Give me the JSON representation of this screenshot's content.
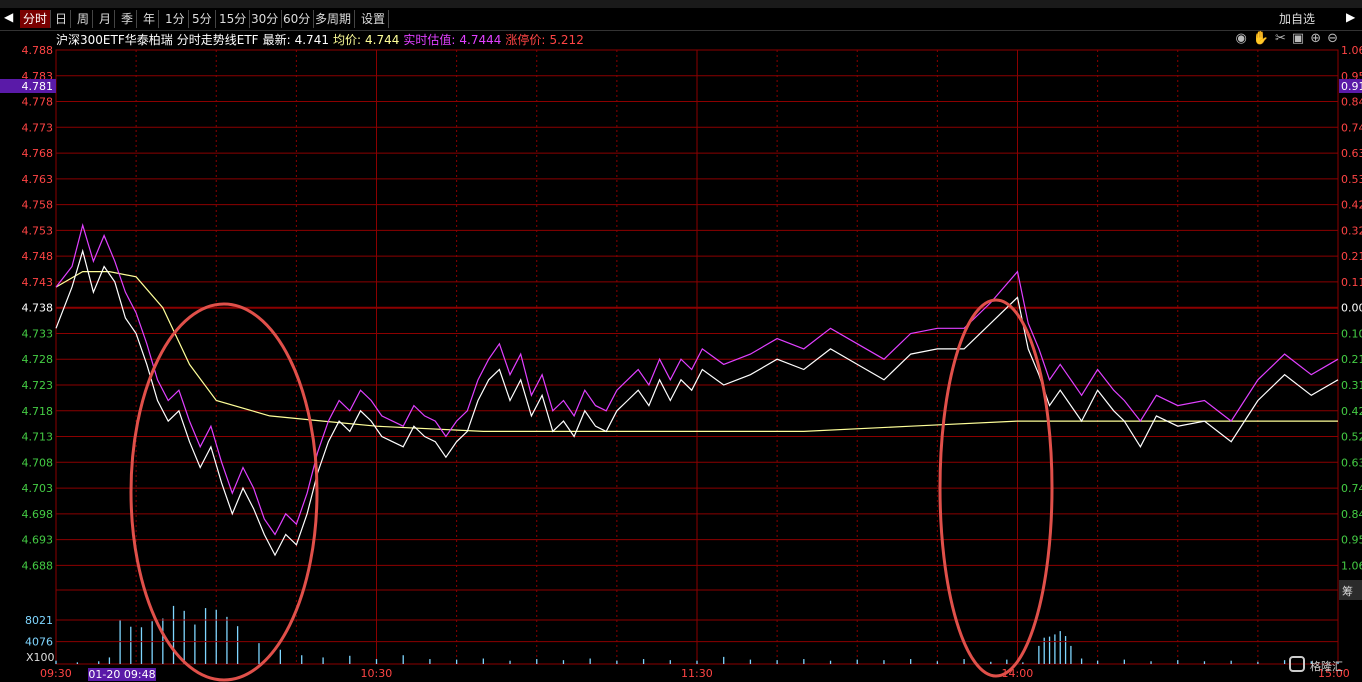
{
  "toolbar": {
    "tabs": [
      "分时",
      "日",
      "周",
      "月",
      "季",
      "年",
      "1分",
      "5分",
      "15分",
      "30分",
      "60分",
      "多周期",
      "设置"
    ],
    "active": "分时",
    "right_label": "加自选"
  },
  "header": {
    "name": "沪深300ETF华泰柏瑞",
    "chart_name": "分时走势线ETF",
    "latest_label": "最新:",
    "latest": "4.741",
    "avg_label": "均价:",
    "avg": "4.744",
    "iopv_label": "实时估值:",
    "iopv": "4.7444",
    "limit_label": "涨停价:",
    "limit": "5.212"
  },
  "colors": {
    "price_line": "#ffffff",
    "iopv_line": "#e040ff",
    "avg_line": "#ffff99",
    "grid": "#8b0000",
    "up_text": "#ff4444",
    "down_text": "#44cc44",
    "volume": "#7fd6ff",
    "annotation": "#e0504a"
  },
  "cursor_label_left": "4.781",
  "cursor_label_right": "0.91",
  "volume_unit": "X100",
  "watermark": "格隆汇",
  "right_edge_label": "筹",
  "chart_data": {
    "type": "line",
    "title": "沪深300ETF华泰柏瑞 分时走势线ETF",
    "prev_close": 4.738,
    "ylim": [
      4.684,
      4.788
    ],
    "y_ticks": [
      "4.788",
      "4.783",
      "4.778",
      "4.773",
      "4.768",
      "4.763",
      "4.758",
      "4.753",
      "4.748",
      "4.743",
      "4.738",
      "4.733",
      "4.728",
      "4.723",
      "4.718",
      "4.713",
      "4.708",
      "4.703",
      "4.698",
      "4.693",
      "4.688"
    ],
    "pct_ticks": [
      "1.06",
      "0.95",
      "0.84",
      "0.74",
      "0.63",
      "0.53",
      "0.42",
      "0.32",
      "0.21",
      "0.11",
      "0.00",
      "0.10",
      "0.21",
      "0.31",
      "0.42",
      "0.52",
      "0.63",
      "0.74",
      "0.84",
      "0.95",
      "1.06"
    ],
    "x_tick_labels": [
      "09:30",
      "10:30",
      "11:30",
      "14:00",
      "15:00"
    ],
    "x_tick_minutes": [
      0,
      60,
      120,
      180,
      240
    ],
    "cursor_time": "01-20 09:48",
    "series": [
      {
        "name": "最新",
        "key": "price",
        "x": [
          0,
          3,
          5,
          7,
          9,
          11,
          13,
          15,
          17,
          19,
          21,
          23,
          25,
          27,
          29,
          31,
          33,
          35,
          37,
          39,
          41,
          43,
          45,
          47,
          49,
          51,
          53,
          55,
          57,
          59,
          61,
          63,
          65,
          67,
          69,
          71,
          73,
          75,
          77,
          79,
          81,
          83,
          85,
          87,
          89,
          91,
          93,
          95,
          97,
          99,
          101,
          103,
          105,
          107,
          109,
          111,
          113,
          115,
          117,
          119,
          121,
          125,
          130,
          135,
          140,
          145,
          150,
          155,
          160,
          165,
          170,
          175,
          180,
          182,
          184,
          186,
          188,
          190,
          192,
          195,
          198,
          200,
          203,
          206,
          210,
          215,
          220,
          225,
          230,
          235,
          240
        ],
        "y": [
          4.734,
          4.742,
          4.749,
          4.741,
          4.746,
          4.743,
          4.736,
          4.733,
          4.727,
          4.72,
          4.716,
          4.718,
          4.712,
          4.707,
          4.711,
          4.704,
          4.698,
          4.703,
          4.699,
          4.694,
          4.69,
          4.694,
          4.692,
          4.698,
          4.706,
          4.712,
          4.716,
          4.714,
          4.718,
          4.716,
          4.713,
          4.712,
          4.711,
          4.715,
          4.713,
          4.712,
          4.709,
          4.712,
          4.714,
          4.72,
          4.724,
          4.726,
          4.72,
          4.724,
          4.717,
          4.721,
          4.714,
          4.716,
          4.713,
          4.718,
          4.715,
          4.714,
          4.718,
          4.72,
          4.722,
          4.719,
          4.724,
          4.72,
          4.724,
          4.722,
          4.726,
          4.723,
          4.725,
          4.728,
          4.726,
          4.73,
          4.727,
          4.724,
          4.729,
          4.73,
          4.73,
          4.735,
          4.74,
          4.73,
          4.725,
          4.719,
          4.722,
          4.719,
          4.716,
          4.722,
          4.718,
          4.716,
          4.711,
          4.717,
          4.715,
          4.716,
          4.712,
          4.72,
          4.725,
          4.721,
          4.724
        ]
      },
      {
        "name": "实时估值",
        "key": "iopv",
        "x": [
          0,
          3,
          5,
          7,
          9,
          11,
          13,
          15,
          17,
          19,
          21,
          23,
          25,
          27,
          29,
          31,
          33,
          35,
          37,
          39,
          41,
          43,
          45,
          47,
          49,
          51,
          53,
          55,
          57,
          59,
          61,
          63,
          65,
          67,
          69,
          71,
          73,
          75,
          77,
          79,
          81,
          83,
          85,
          87,
          89,
          91,
          93,
          95,
          97,
          99,
          101,
          103,
          105,
          107,
          109,
          111,
          113,
          115,
          117,
          119,
          121,
          125,
          130,
          135,
          140,
          145,
          150,
          155,
          160,
          165,
          170,
          175,
          180,
          182,
          184,
          186,
          188,
          190,
          192,
          195,
          198,
          200,
          203,
          206,
          210,
          215,
          220,
          225,
          230,
          235,
          240
        ],
        "y": [
          4.742,
          4.746,
          4.754,
          4.747,
          4.752,
          4.747,
          4.741,
          4.737,
          4.731,
          4.724,
          4.72,
          4.722,
          4.716,
          4.711,
          4.715,
          4.708,
          4.702,
          4.707,
          4.703,
          4.697,
          4.694,
          4.698,
          4.696,
          4.702,
          4.71,
          4.716,
          4.72,
          4.718,
          4.722,
          4.72,
          4.717,
          4.716,
          4.715,
          4.719,
          4.717,
          4.716,
          4.713,
          4.716,
          4.718,
          4.724,
          4.728,
          4.731,
          4.725,
          4.729,
          4.721,
          4.725,
          4.718,
          4.72,
          4.717,
          4.722,
          4.719,
          4.718,
          4.722,
          4.724,
          4.726,
          4.723,
          4.728,
          4.724,
          4.728,
          4.726,
          4.73,
          4.727,
          4.729,
          4.732,
          4.73,
          4.734,
          4.731,
          4.728,
          4.733,
          4.734,
          4.734,
          4.739,
          4.745,
          4.735,
          4.73,
          4.724,
          4.727,
          4.724,
          4.721,
          4.726,
          4.722,
          4.72,
          4.716,
          4.721,
          4.719,
          4.72,
          4.716,
          4.724,
          4.729,
          4.725,
          4.728
        ]
      },
      {
        "name": "均价",
        "key": "avg",
        "x": [
          0,
          5,
          10,
          15,
          20,
          25,
          30,
          40,
          50,
          60,
          80,
          100,
          120,
          140,
          160,
          180,
          200,
          220,
          240
        ],
        "y": [
          4.742,
          4.745,
          4.745,
          4.744,
          4.738,
          4.727,
          4.72,
          4.717,
          4.716,
          4.715,
          4.714,
          4.714,
          4.714,
          4.714,
          4.715,
          4.716,
          4.716,
          4.716,
          4.716
        ]
      },
      {
        "name": "成交量",
        "key": "volume",
        "unit": "X100",
        "ticks": [
          "8021",
          "4076"
        ],
        "x": [
          0,
          4,
          8,
          10,
          12,
          14,
          16,
          18,
          20,
          22,
          24,
          26,
          28,
          30,
          32,
          34,
          38,
          42,
          46,
          50,
          55,
          60,
          65,
          70,
          75,
          80,
          85,
          90,
          95,
          100,
          105,
          110,
          115,
          120,
          125,
          130,
          135,
          140,
          145,
          150,
          155,
          160,
          165,
          170,
          175,
          178,
          181,
          184,
          185,
          186,
          187,
          188,
          189,
          190,
          192,
          195,
          200,
          205,
          210,
          215,
          220,
          225,
          230,
          235,
          240
        ],
        "y": [
          600,
          300,
          500,
          1200,
          8000,
          6800,
          6700,
          7800,
          8300,
          10600,
          9700,
          7200,
          10200,
          9900,
          8600,
          6900,
          3800,
          2600,
          1600,
          1200,
          1500,
          900,
          1600,
          900,
          800,
          1000,
          600,
          900,
          700,
          1000,
          600,
          900,
          700,
          600,
          1300,
          800,
          700,
          900,
          600,
          800,
          700,
          900,
          500,
          900,
          400,
          800,
          300,
          3300,
          4800,
          5000,
          5400,
          6000,
          5100,
          3300,
          1000,
          600,
          800,
          500,
          700,
          500,
          600,
          400,
          700,
          500,
          400
        ]
      }
    ],
    "grid": true
  }
}
